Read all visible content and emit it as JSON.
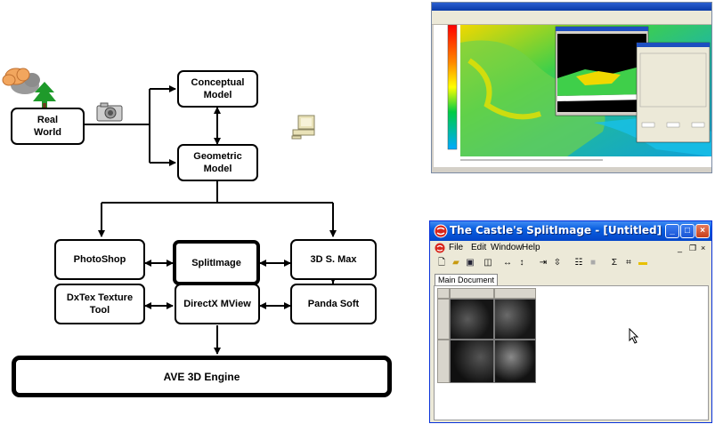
{
  "diagram": {
    "nodes": {
      "real_world": "Real\nWorld",
      "conceptual_model": "Conceptual\nModel",
      "geometric_model": "Geometric\nModel",
      "photoshop": "PhotoShop",
      "splitimage": "SplitImage",
      "max": "3D S. Max",
      "dxtex": "DxTex Texture\nTool",
      "directx": "DirectX MView",
      "panda": "Panda Soft",
      "engine": "AVE 3D Engine"
    },
    "icons": [
      "cloud-icon",
      "tree-icon",
      "camera-icon",
      "computer-icon"
    ]
  },
  "screenshot_bottom": {
    "title": "The Castle's SplitImage - [Untitled]",
    "menu": [
      "File",
      "Edit",
      "Window",
      "Help"
    ],
    "tab": "Main Document"
  }
}
